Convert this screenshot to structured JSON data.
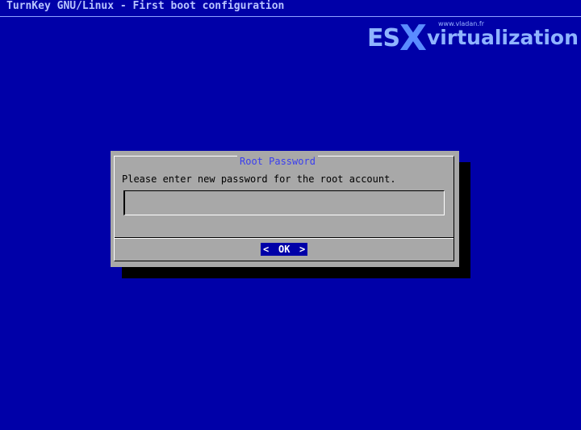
{
  "screen": {
    "backtitle": "TurnKey GNU/Linux - First boot configuration"
  },
  "watermark": {
    "url": "www.vladan.fr",
    "brand_es": "ES",
    "brand_x": "X",
    "brand_rest": "virtualization"
  },
  "dialog": {
    "title": "Root Password",
    "prompt": "Please enter new password for the root account.",
    "password_value": "",
    "ok_button": {
      "left": "<",
      "label": "OK",
      "right": ">"
    }
  },
  "colors": {
    "background": "#0000a8",
    "dialog": "#a8a8a8",
    "title": "#3a3ef0",
    "button_bg": "#0000a8",
    "button_fg": "#ffffff"
  }
}
